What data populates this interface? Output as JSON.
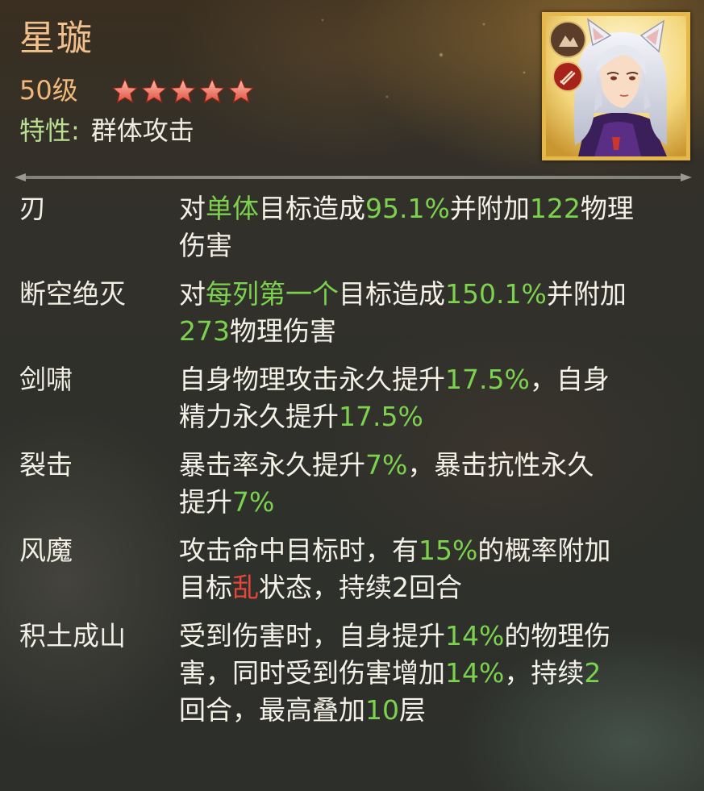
{
  "hero": {
    "name": "星璇",
    "level": "50级",
    "stars": 5,
    "trait_label": "特性:",
    "trait_value": "群体攻击",
    "portrait_badges": [
      "earth-element-icon",
      "physical-attack-icon"
    ]
  },
  "skills": [
    {
      "name": "刃",
      "desc": [
        {
          "t": "对",
          "c": "w"
        },
        {
          "t": "单体",
          "c": "g"
        },
        {
          "t": "目标造成",
          "c": "w"
        },
        {
          "t": "95.1%",
          "c": "g"
        },
        {
          "t": "并附加",
          "c": "w"
        },
        {
          "t": "122",
          "c": "g"
        },
        {
          "t": "物理",
          "c": "w"
        },
        {
          "br": true
        },
        {
          "t": "伤害",
          "c": "w"
        }
      ]
    },
    {
      "name": "断空绝灭",
      "desc": [
        {
          "t": "对",
          "c": "w"
        },
        {
          "t": "每列第一个",
          "c": "g"
        },
        {
          "t": "目标造成",
          "c": "w"
        },
        {
          "t": "150.1%",
          "c": "g"
        },
        {
          "t": "并附加",
          "c": "w"
        },
        {
          "br": true
        },
        {
          "t": "273",
          "c": "g"
        },
        {
          "t": "物理伤害",
          "c": "w"
        }
      ]
    },
    {
      "name": "剑啸",
      "desc": [
        {
          "t": "自身物理攻击永久提升",
          "c": "w"
        },
        {
          "t": "17.5%",
          "c": "g"
        },
        {
          "t": "，自身",
          "c": "w"
        },
        {
          "br": true
        },
        {
          "t": "精力永久提升",
          "c": "w"
        },
        {
          "t": "17.5%",
          "c": "g"
        }
      ]
    },
    {
      "name": "裂击",
      "desc": [
        {
          "t": "暴击率永久提升",
          "c": "w"
        },
        {
          "t": "7%",
          "c": "g"
        },
        {
          "t": "，暴击抗性永久",
          "c": "w"
        },
        {
          "br": true
        },
        {
          "t": "提升",
          "c": "w"
        },
        {
          "t": "7%",
          "c": "g"
        }
      ]
    },
    {
      "name": "风魔",
      "desc": [
        {
          "t": "攻击命中目标时，有",
          "c": "w"
        },
        {
          "t": "15%",
          "c": "g"
        },
        {
          "t": "的概率附加",
          "c": "w"
        },
        {
          "br": true
        },
        {
          "t": "目标",
          "c": "w"
        },
        {
          "t": "乱",
          "c": "r"
        },
        {
          "t": "状态，持续2回合",
          "c": "w"
        }
      ]
    },
    {
      "name": "积土成山",
      "desc": [
        {
          "t": "受到伤害时，自身提升",
          "c": "w"
        },
        {
          "t": "14%",
          "c": "g"
        },
        {
          "t": "的物理伤",
          "c": "w"
        },
        {
          "br": true
        },
        {
          "t": "害，同时受到伤害增加",
          "c": "w"
        },
        {
          "t": "14%",
          "c": "g"
        },
        {
          "t": "，持续",
          "c": "w"
        },
        {
          "t": "2",
          "c": "g"
        },
        {
          "br": true
        },
        {
          "t": "回合，最高叠加",
          "c": "w"
        },
        {
          "t": "10",
          "c": "g"
        },
        {
          "t": "层",
          "c": "w"
        }
      ]
    }
  ],
  "colors": {
    "name": "#f2c08c",
    "highlight": "#7cd24e",
    "status": "#e8463a",
    "text": "#f4f1e6",
    "frame": "#e6b84a"
  }
}
